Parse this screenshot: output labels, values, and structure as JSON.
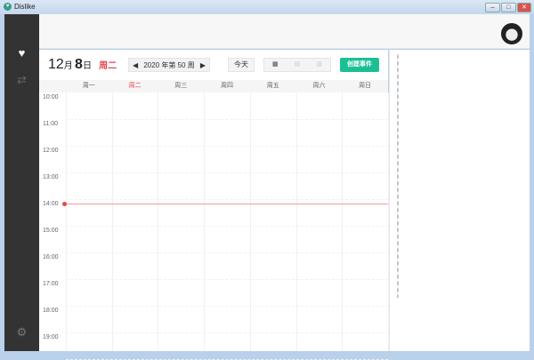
{
  "window": {
    "title": "Dislike",
    "min": "–",
    "max": "□",
    "close": "✕"
  },
  "sidebar": {
    "items": [
      {
        "icon": "heart-icon",
        "glyph": "♥"
      },
      {
        "icon": "sync-icon",
        "glyph": "⇄"
      }
    ],
    "settings_glyph": "⚙"
  },
  "toolbar": {
    "month": "12",
    "month_unit": "月",
    "day": "8",
    "day_unit": "日",
    "weekday": "周二",
    "week_label": "2020 年第 50 周",
    "prev": "◀",
    "next": "▶",
    "today": "今天",
    "views": [
      "▦",
      "▤",
      "▥"
    ],
    "create": "创建事件"
  },
  "days": [
    "周一",
    "周二",
    "周三",
    "周四",
    "周五",
    "周六",
    "周日"
  ],
  "current_day_index": 1,
  "times": [
    "10:00",
    "11:00",
    "12:00",
    "13:00",
    "14:00",
    "15:00",
    "16:00",
    "17:00",
    "18:00",
    "19:00"
  ],
  "now_time": "14:00",
  "colors": {
    "accent": "#1cbf94",
    "today": "#e5484d",
    "sidebar": "#333333"
  }
}
